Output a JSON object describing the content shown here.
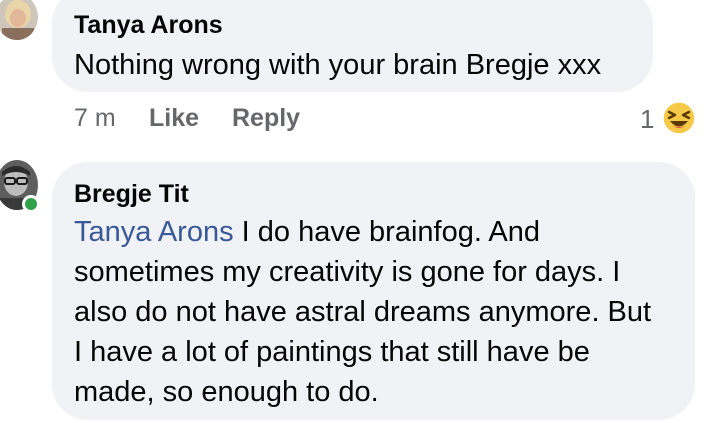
{
  "comment1": {
    "author": "Tanya Arons",
    "text": "Nothing wrong with your brain Bregje xxx",
    "time": "7 m",
    "like_label": "Like",
    "reply_label": "Reply",
    "reaction_count": "1",
    "reaction_icon": "laughing-emoji-icon"
  },
  "comment2": {
    "author": "Bregje Tit",
    "mention": "Tanya Arons",
    "lines": [
      " I do have brainfog. And",
      "sometimes my creativity is gone for days. I",
      "also do not have astral dreams anymore. But",
      "I have a lot of paintings that still have be",
      "made, so enough to do."
    ],
    "online": true
  },
  "colors": {
    "bubble": "#f0f2f5",
    "mention": "#385898",
    "meta": "#65676b",
    "online": "#31a24c"
  }
}
